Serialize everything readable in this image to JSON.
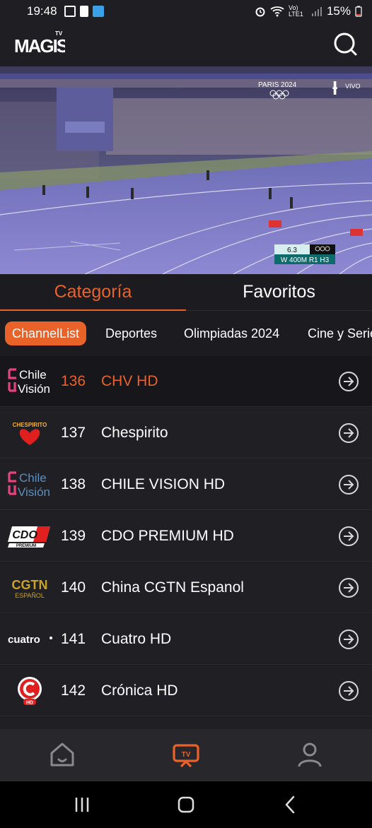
{
  "status_bar": {
    "time": "19:48",
    "battery": "15%",
    "network": "Vo) LTE1"
  },
  "app": {
    "logo_text": "MAGIS TV"
  },
  "video": {
    "overlay_brand": "PARIS 2024",
    "live_label": "VIVO",
    "score_time": "6.3",
    "race_label": "W 400M R1 H3"
  },
  "tabs": [
    {
      "label": "Categoría",
      "active": true
    },
    {
      "label": "Favoritos",
      "active": false
    }
  ],
  "chips": [
    {
      "label": "ChannelList",
      "active": true
    },
    {
      "label": "Deportes",
      "active": false
    },
    {
      "label": "Olimpiadas 2024",
      "active": false
    },
    {
      "label": "Cine y Series",
      "active": false
    }
  ],
  "channels": [
    {
      "number": "136",
      "name": "CHV HD",
      "logo": "chilevision-logo",
      "selected": true
    },
    {
      "number": "137",
      "name": "Chespirito",
      "logo": "chespirito-logo",
      "selected": false
    },
    {
      "number": "138",
      "name": "CHILE VISION HD",
      "logo": "chilevision-logo",
      "selected": false
    },
    {
      "number": "139",
      "name": "CDO PREMIUM HD",
      "logo": "cdo-premium-logo",
      "selected": false
    },
    {
      "number": "140",
      "name": "China CGTN Espanol",
      "logo": "cgtn-espanol-logo",
      "selected": false
    },
    {
      "number": "141",
      "name": "Cuatro HD",
      "logo": "cuatro-logo",
      "selected": false
    },
    {
      "number": "142",
      "name": "Crónica HD",
      "logo": "cronica-logo",
      "selected": false
    }
  ],
  "logo_texts": {
    "chv_top": "Chile",
    "chv_bottom": "Visión",
    "chespirito": "CHESPIRITO",
    "cdo": "CDO",
    "cdo_sub": "PREMIUM",
    "cgtn": "CGTN",
    "cgtn_sub": "ESPAÑOL",
    "cuatro": "cuatro",
    "cronica_hd": "HD"
  },
  "bottom_nav": [
    {
      "name": "home",
      "icon": "home-icon",
      "active": false
    },
    {
      "name": "tv",
      "icon": "tv-icon",
      "active": true
    },
    {
      "name": "profile",
      "icon": "profile-icon",
      "active": false
    }
  ],
  "colors": {
    "accent": "#e8622a",
    "background": "#1c1c20",
    "row": "#1f1f24",
    "nav": "#28282c"
  }
}
